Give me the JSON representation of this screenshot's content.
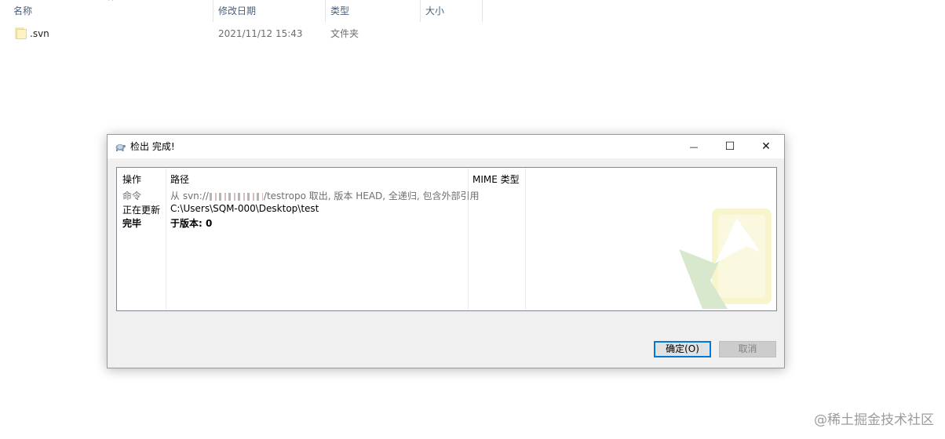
{
  "explorer": {
    "columns": {
      "name": "名称",
      "modified": "修改日期",
      "type": "类型",
      "size": "大小"
    },
    "sort_indicator": "^",
    "rows": [
      {
        "name": ".svn",
        "modified": "2021/11/12 15:43",
        "type": "文件夹",
        "size": ""
      }
    ]
  },
  "dialog": {
    "title": "检出 完成!",
    "window_controls": {
      "minimize": "—",
      "maximize": "☐",
      "close": "✕"
    },
    "log": {
      "headers": {
        "action": "操作",
        "path": "路径",
        "mime": "MIME 类型"
      },
      "rows": [
        {
          "action": "命令",
          "path_prefix": "从 svn://",
          "path_suffix": "/testropo 取出, 版本 HEAD, 全递归, 包含外部引用",
          "style": "gray"
        },
        {
          "action": "正在更新",
          "path": "C:\\Users\\SQM-000\\Desktop\\test",
          "style": "normal"
        },
        {
          "action": "完毕",
          "path": "于版本: 0",
          "style": "bold"
        }
      ]
    },
    "buttons": {
      "ok": "确定(O)",
      "cancel": "取消"
    }
  },
  "site_watermark": "@稀土掘金技术社区",
  "colors": {
    "default_button_border": "#0078d7",
    "header_text": "#4c607a"
  }
}
